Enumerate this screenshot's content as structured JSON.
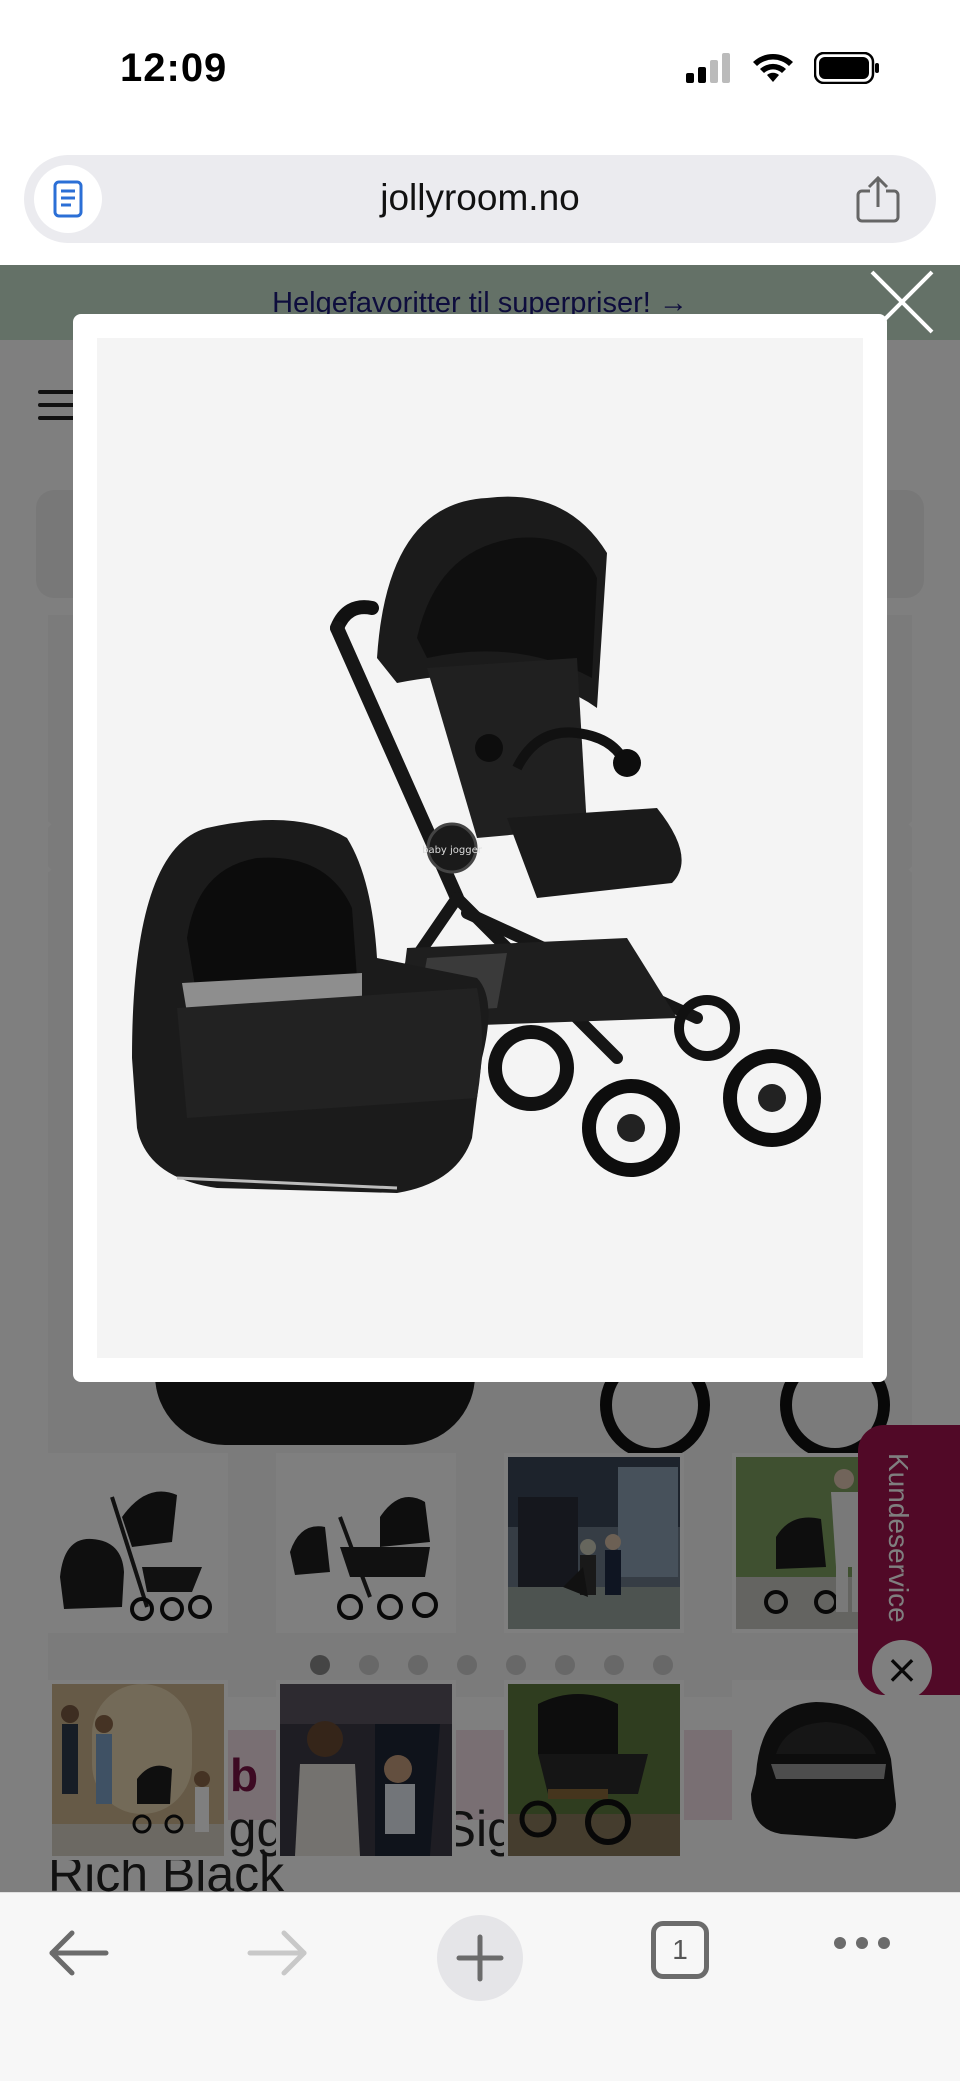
{
  "status_bar": {
    "time": "12:09",
    "icons": [
      "signal-icon",
      "wifi-icon",
      "battery-icon"
    ]
  },
  "browser": {
    "url": "jollyroom.no",
    "reader_icon": "reader-mode-icon",
    "share_icon": "share-icon"
  },
  "page": {
    "promo_banner": "Helgefavoritter til superpriser! →",
    "promo_strip": "b   rts   to",
    "product_title_line1": "Baby Jogger City Sights",
    "product_title_line2": "Rich Black",
    "side_tab_label": "Kundeservice",
    "side_tab_close": "×",
    "gallery_dots_total": 8,
    "gallery_dot_active": 1
  },
  "lightbox": {
    "image_alt": "Baby Jogger stroller with carrycot in black",
    "brand_logo_text": "baby jogger",
    "thumbnails": [
      {
        "alt": "Stroller with carrycot"
      },
      {
        "alt": "Stroller with seat and bassinet"
      },
      {
        "alt": "Family outside house with stroller"
      },
      {
        "alt": "Woman pushing pram in park"
      },
      {
        "alt": "Family walking with stroller"
      },
      {
        "alt": "Mother with baby in stroller"
      },
      {
        "alt": "Stroller on forest path"
      },
      {
        "alt": "Black carrycot"
      }
    ]
  },
  "toolbar": {
    "tab_count": "1"
  },
  "colors": {
    "promo_banner_bg": "#c9e3cf",
    "promo_text": "#1d1a7a",
    "side_tab": "#a3134f",
    "reader_icon": "#2b6fd6"
  }
}
